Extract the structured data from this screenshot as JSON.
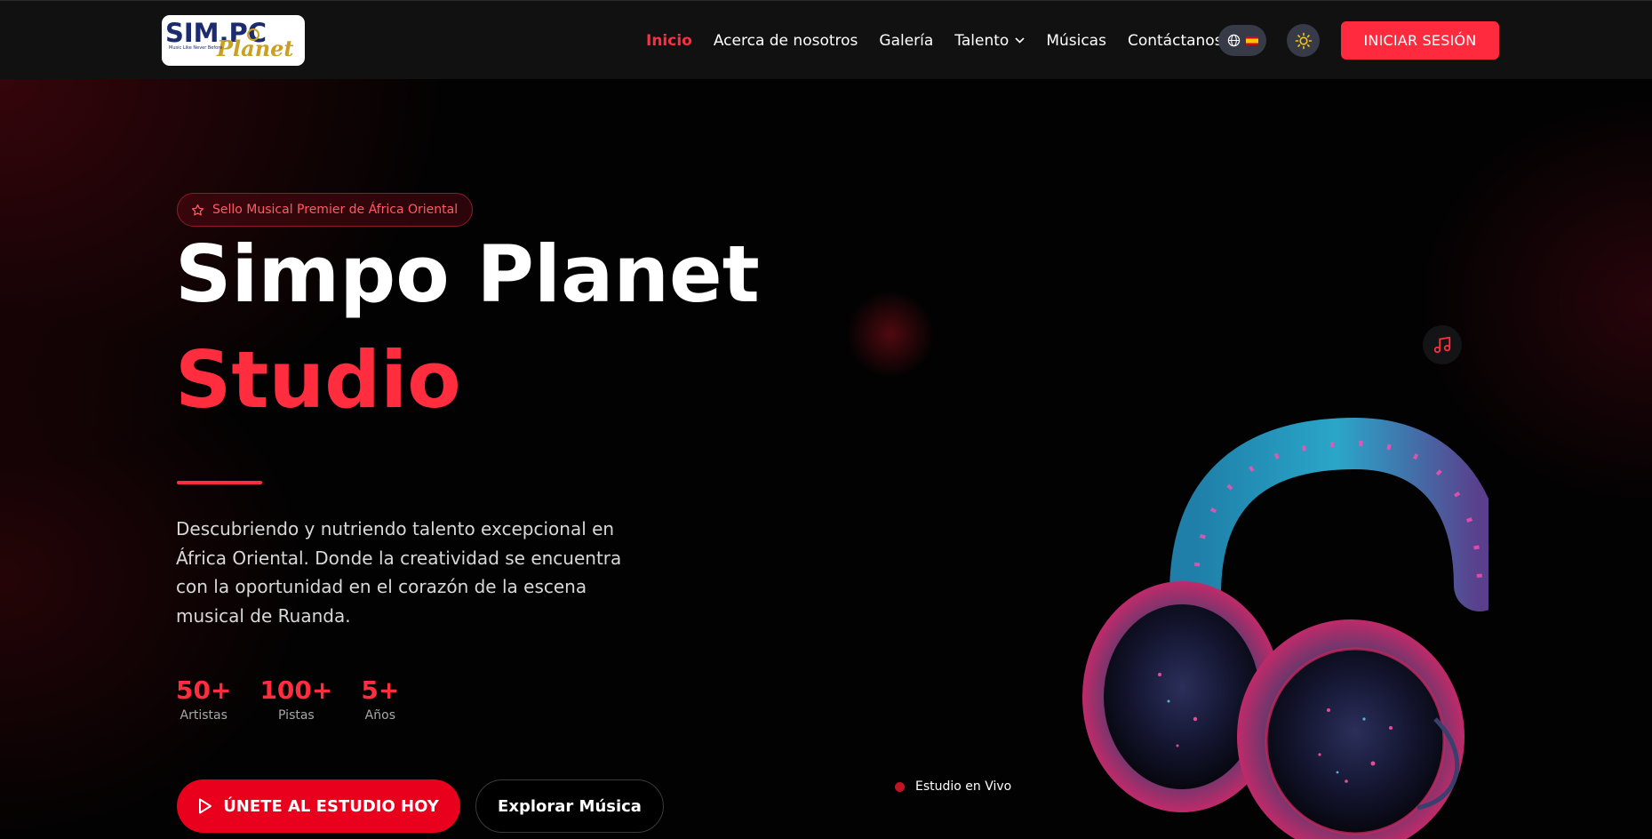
{
  "logo": {
    "line1": "SIM.PC",
    "line2": "Planet",
    "tagline": "Music Like Never Before"
  },
  "nav": {
    "items": [
      {
        "label": "Inicio",
        "active": true
      },
      {
        "label": "Acerca de nosotros"
      },
      {
        "label": "Galería"
      },
      {
        "label": "Talento",
        "dropdown": true
      },
      {
        "label": "Músicas"
      },
      {
        "label": "Contáctanos"
      }
    ],
    "language_icon": "globe-icon",
    "language_flag": "spain-flag",
    "theme_icon": "sun-icon",
    "login_label": "INICIAR SESIÓN"
  },
  "hero": {
    "badge": "Sello Musical Premier de África Oriental",
    "title_line1": "Simpo Planet",
    "title_line2": "Studio",
    "description": "Descubriendo y nutriendo talento excepcional en África Oriental. Donde la creatividad se encuentra con la oportunidad en el corazón de la escena musical de Ruanda.",
    "stats": [
      {
        "value": "50+",
        "label": "Artistas"
      },
      {
        "value": "100+",
        "label": "Pistas"
      },
      {
        "value": "5+",
        "label": "Años"
      }
    ],
    "cta_primary": "ÚNETE AL ESTUDIO HOY",
    "cta_secondary": "Explorar Música",
    "live_label": "Estudio en Vivo",
    "music_icon": "music-note-icon"
  },
  "colors": {
    "accent": "#ff2d3d",
    "navbar": "#111111",
    "background": "#020202"
  }
}
